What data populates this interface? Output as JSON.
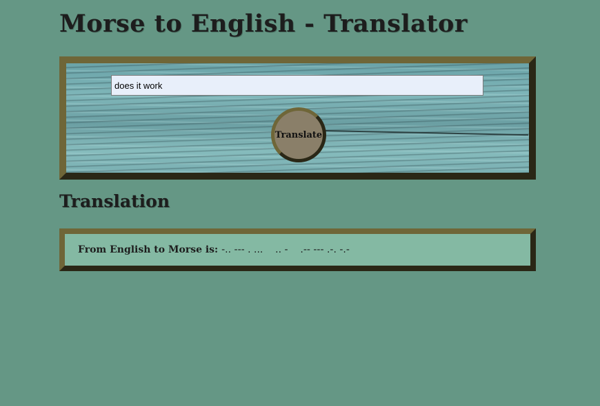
{
  "header": {
    "title": "Morse to English - Translator"
  },
  "translator": {
    "input_value": "does it work",
    "button_label": "Translate"
  },
  "result": {
    "heading": "Translation",
    "label": "From English to Morse is: ",
    "value": "-.. --- . ...    .. -    .-- --- .-. -.-"
  }
}
